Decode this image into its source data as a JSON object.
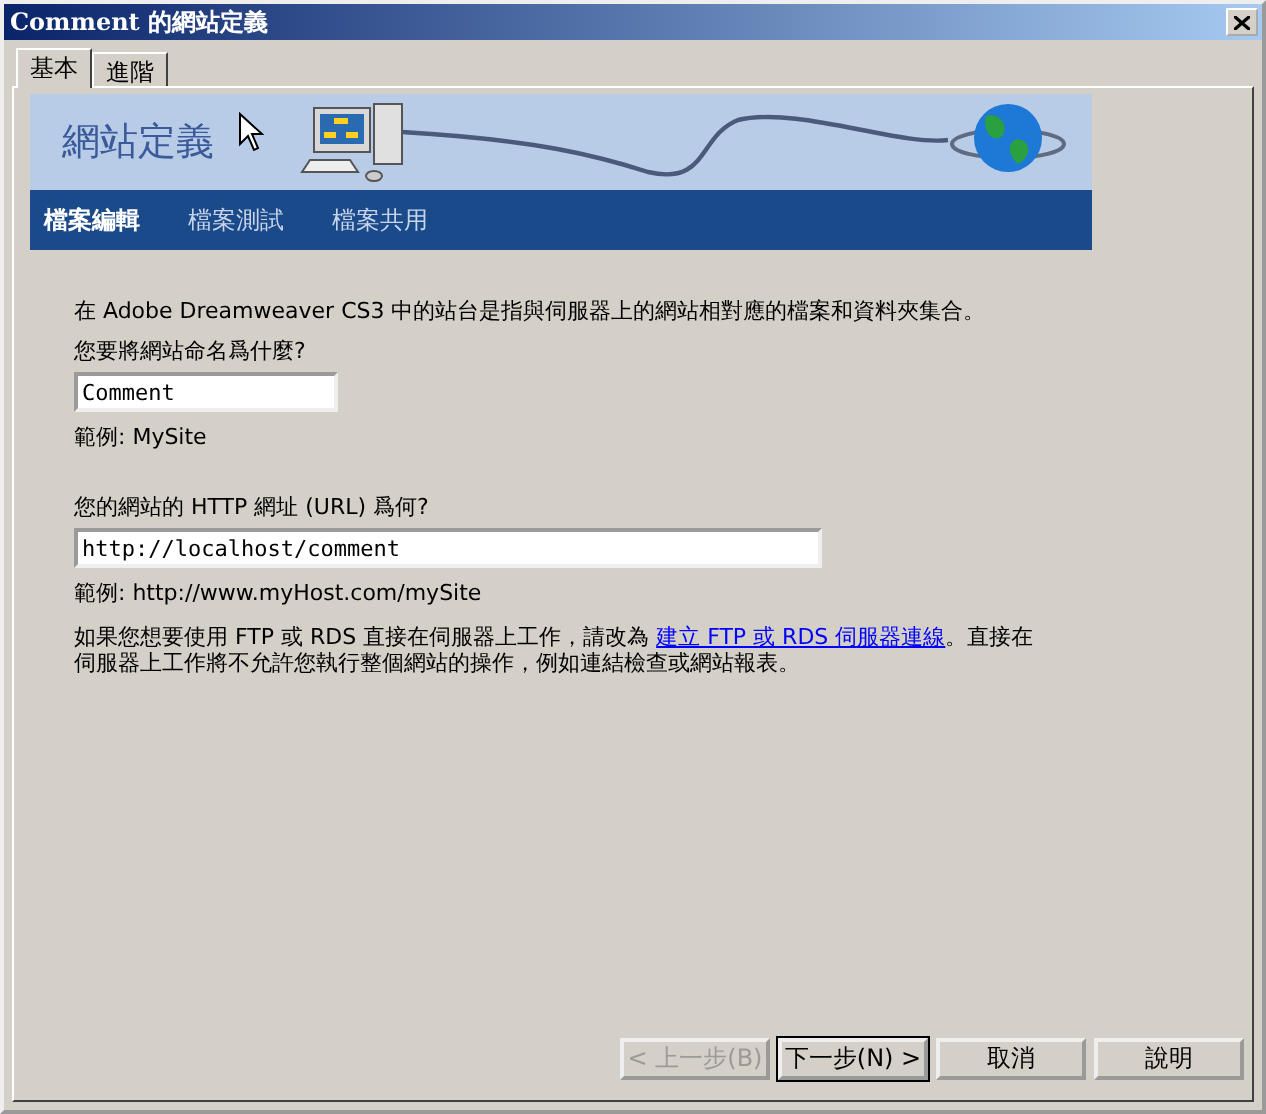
{
  "window": {
    "title": "Comment 的網站定義"
  },
  "tabs": [
    {
      "label": "基本",
      "selected": true
    },
    {
      "label": "進階",
      "selected": false
    }
  ],
  "banner": {
    "title": "網站定義",
    "steps": [
      {
        "label": "檔案編輯",
        "selected": true
      },
      {
        "label": "檔案測試",
        "selected": false
      },
      {
        "label": "檔案共用",
        "selected": false
      }
    ]
  },
  "intro": "在 Adobe Dreamweaver CS3 中的站台是指與伺服器上的網站相對應的檔案和資料夾集合。",
  "fields": [
    {
      "label": "您要將網站命名爲什麼?",
      "value": "Comment",
      "example": "範例: MySite"
    },
    {
      "label": "您的網站的 HTTP 網址 (URL) 爲何?",
      "value": "http://localhost/comment",
      "example": "範例: http://www.myHost.com/mySite"
    }
  ],
  "note": {
    "before": "如果您想要使用 FTP 或 RDS 直接在伺服器上工作，請改為 ",
    "link": "建立 FTP 或 RDS 伺服器連線",
    "after": "。直接在伺服器上工作將不允許您執行整個網站的操作，例如連結檢查或網站報表。"
  },
  "buttons": [
    {
      "label": "< 上一步(B)",
      "disabled": true,
      "default": false
    },
    {
      "label": "下一步(N) >",
      "disabled": false,
      "default": true
    },
    {
      "label": "取消",
      "disabled": false,
      "default": false
    },
    {
      "label": "說明",
      "disabled": false,
      "default": false
    }
  ]
}
